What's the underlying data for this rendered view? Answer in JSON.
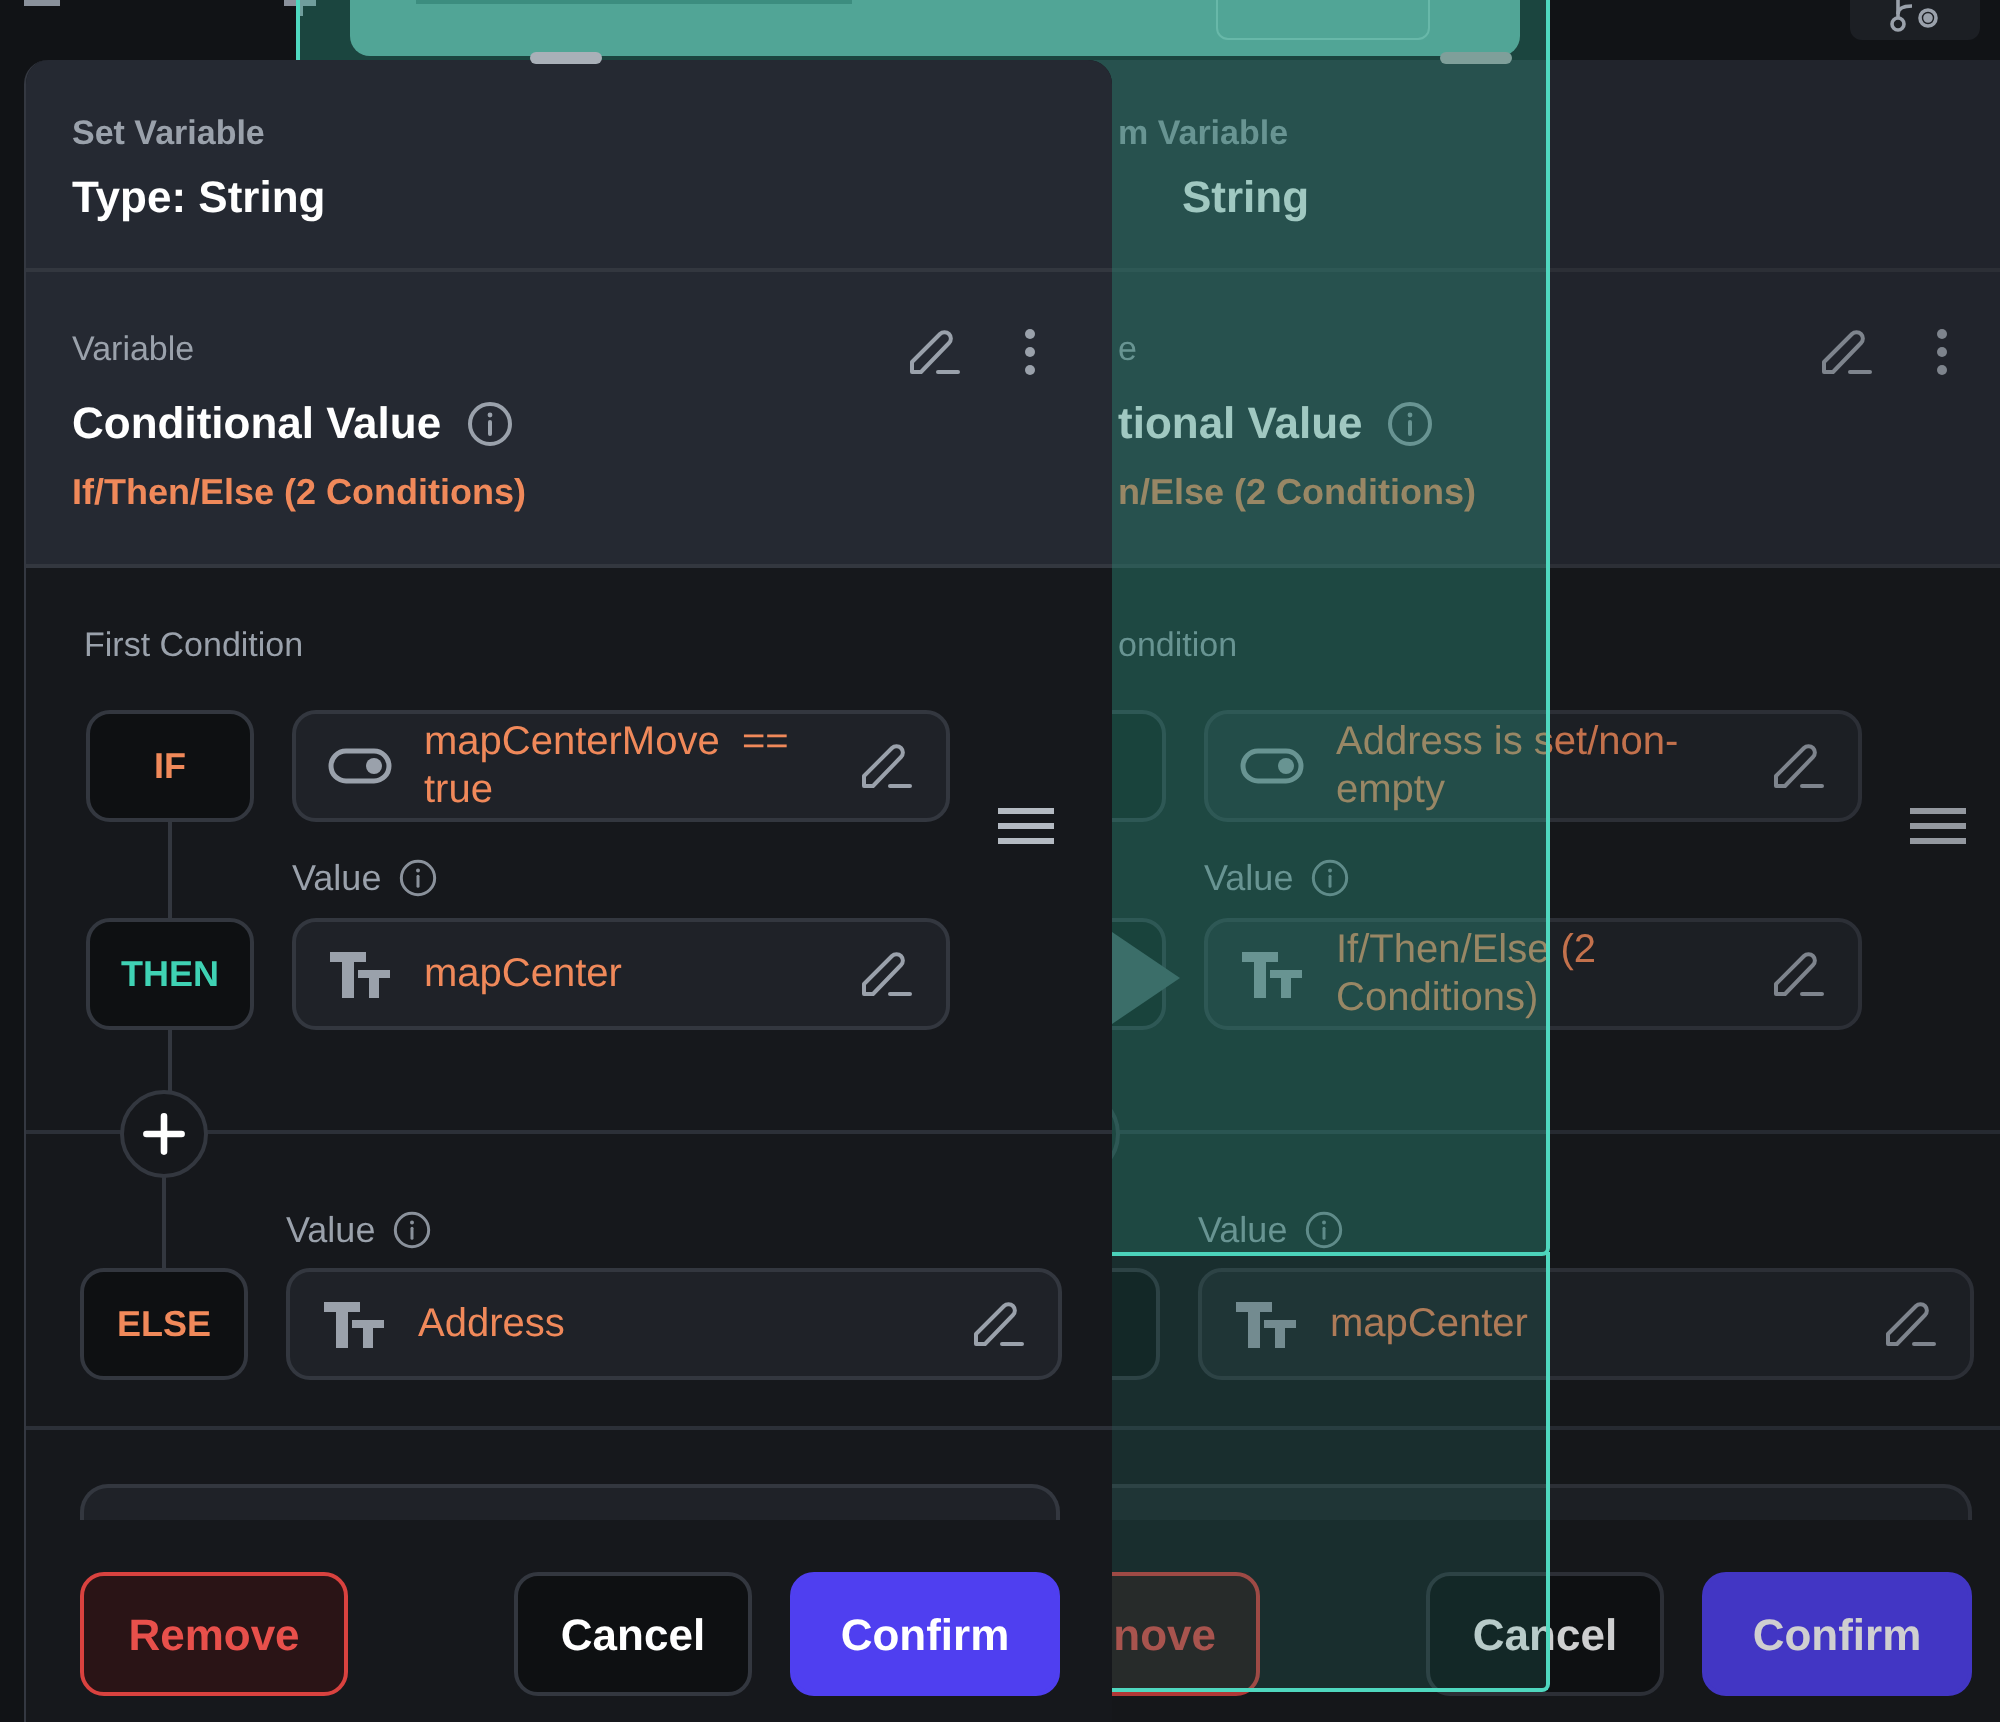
{
  "panels": [
    {
      "active": true,
      "subtitle": "Set Variable",
      "title": "Type: String",
      "variable": {
        "label": "Variable",
        "name": "Conditional Value",
        "summary": "If/Then/Else (2 Conditions)"
      },
      "condition": {
        "heading": "First Condition",
        "if_label": "IF",
        "expression": "mapCenterMove  == true",
        "value_label": "Value",
        "then_label": "THEN",
        "value": "mapCenter"
      },
      "otherwise": {
        "value_label": "Value",
        "else_label": "ELSE",
        "value": "Address"
      },
      "buttons": [
        {
          "kind": "danger",
          "label": "Remove"
        },
        {
          "kind": "secondary",
          "label": "Cancel"
        },
        {
          "kind": "primary",
          "label": "Confirm"
        }
      ]
    },
    {
      "active": false,
      "subtitle": "m Variable",
      "title": "String",
      "variable": {
        "label": "e",
        "name": "tional Value",
        "summary": "n/Else (2 Conditions)"
      },
      "condition": {
        "heading": "ondition",
        "expression": "Address is set/non-empty",
        "value_label": "Value",
        "value": "If/Then/Else (2 Conditions)"
      },
      "otherwise": {
        "value_label": "Value",
        "value": "mapCenter"
      },
      "buttons": [
        {
          "kind": "danger",
          "label": "nove"
        },
        {
          "kind": "secondary",
          "label": "Cancel"
        },
        {
          "kind": "primary",
          "label": "Confirm"
        }
      ]
    }
  ]
}
